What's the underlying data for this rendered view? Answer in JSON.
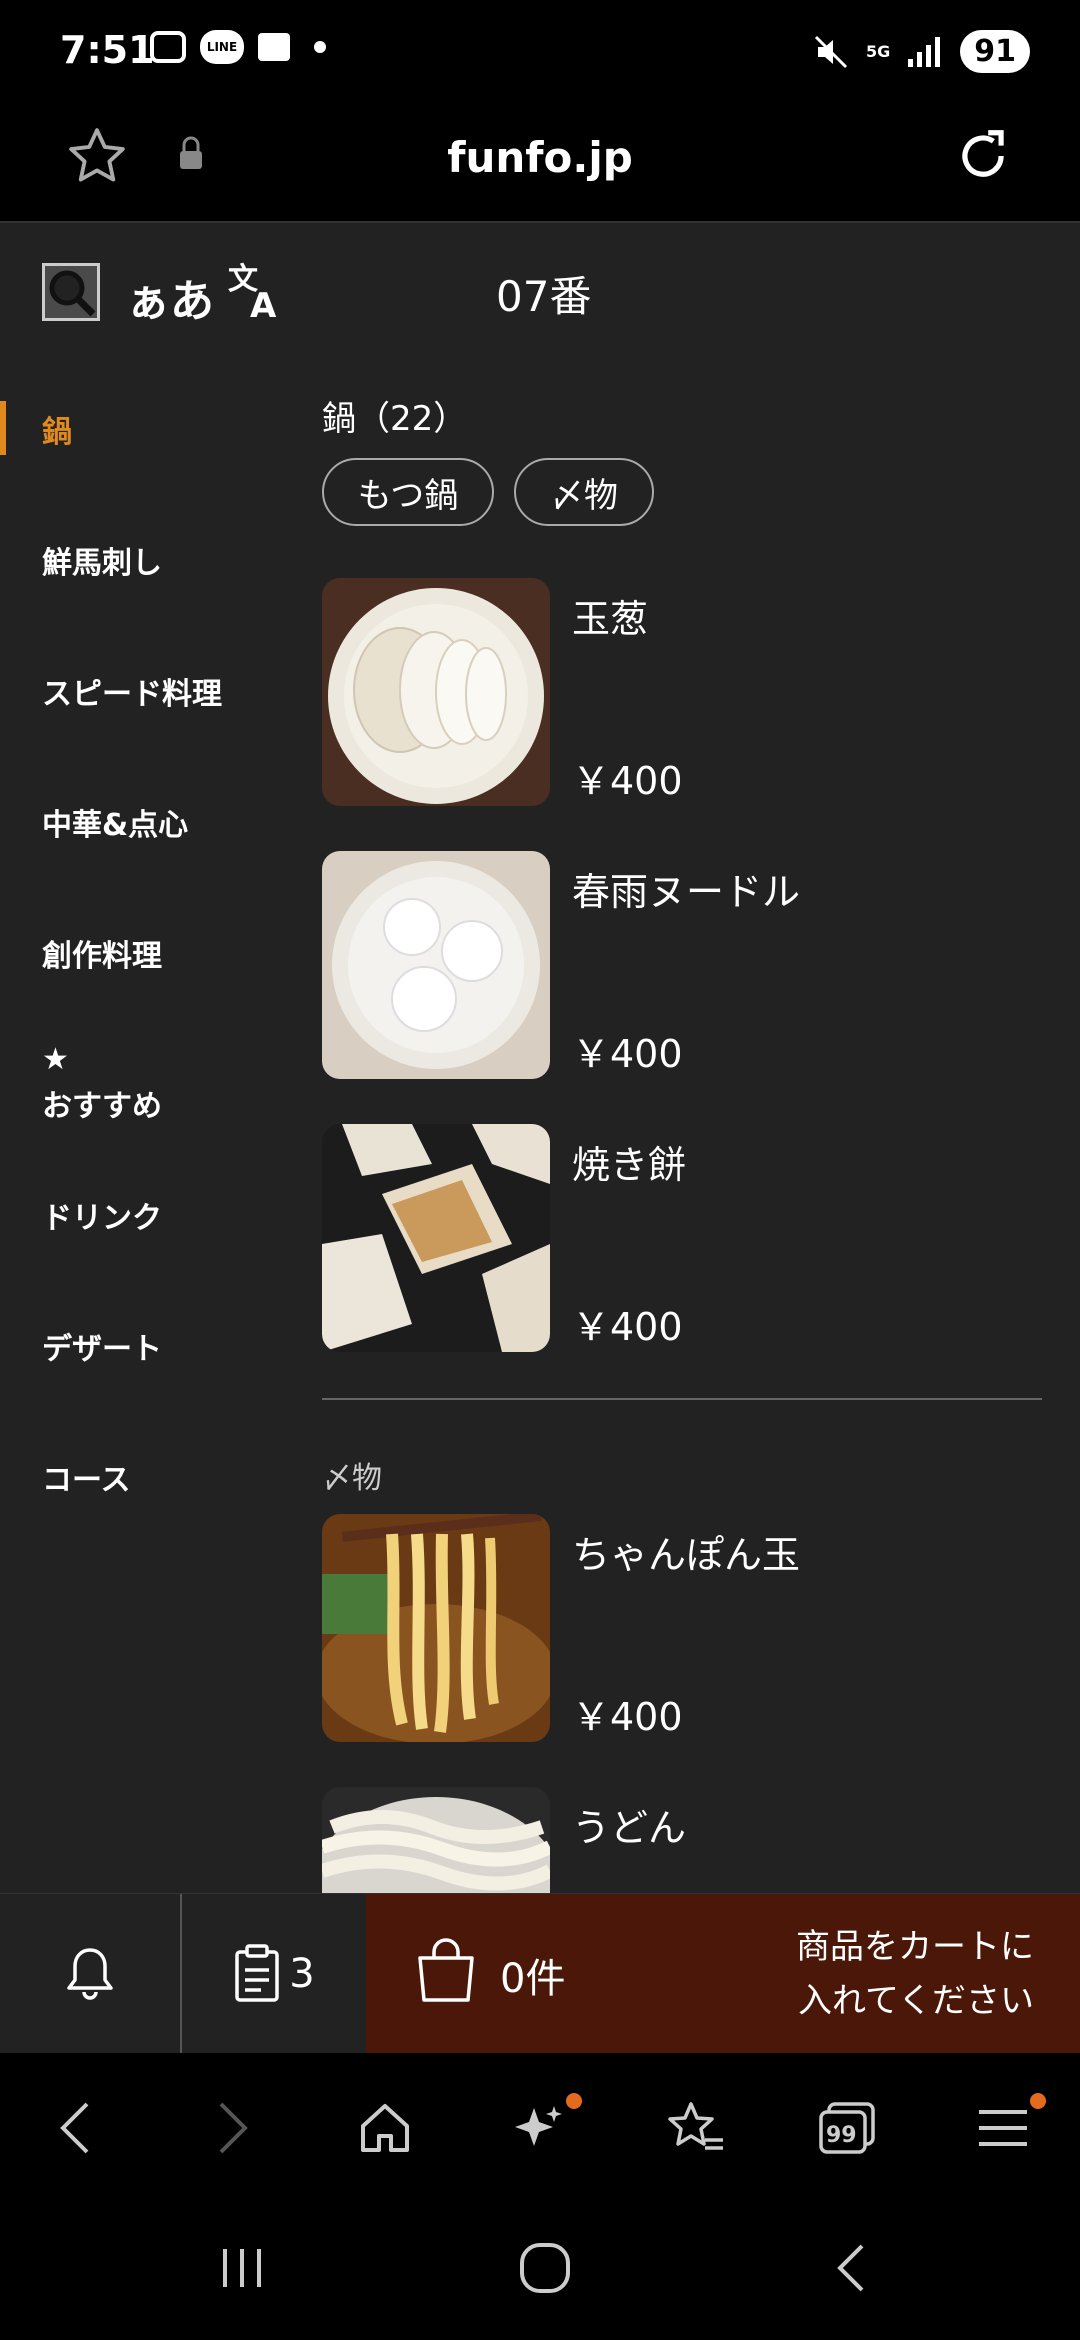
{
  "status_bar": {
    "time": "7:51",
    "network": "5G",
    "battery": "91",
    "line_label": "LINE"
  },
  "browser": {
    "url": "funfo.jp"
  },
  "header": {
    "lang_label": "ぁあ",
    "table_number": "07番"
  },
  "sidebar": {
    "items": [
      {
        "label": "鍋",
        "active": true
      },
      {
        "label": "鮮馬刺し"
      },
      {
        "label": "スピード料理"
      },
      {
        "label": "中華&点心"
      },
      {
        "label": "創作料理"
      },
      {
        "label": "おすすめ",
        "icon": "star-icon"
      },
      {
        "label": "ドリンク"
      },
      {
        "label": "デザート"
      },
      {
        "label": "コース"
      }
    ]
  },
  "category": {
    "title": "鍋（22）",
    "chips": [
      "もつ鍋",
      "〆物"
    ],
    "items": [
      {
        "name": "玉葱",
        "price": "￥400"
      },
      {
        "name": "春雨ヌードル",
        "price": "￥400"
      },
      {
        "name": "焼き餅",
        "price": "￥400"
      }
    ],
    "sub_title": "〆物",
    "sub_items": [
      {
        "name": "ちゃんぽん玉",
        "price": "￥400"
      },
      {
        "name": "うどん",
        "price": ""
      }
    ]
  },
  "cart_bar": {
    "orders_count": "3",
    "cart_count": "0件",
    "cart_message_line1": "商品をカートに",
    "cart_message_line2": "入れてください"
  },
  "colors": {
    "accent": "#e08a1e",
    "cart_bg": "#4a1708",
    "app_bg": "#222222"
  }
}
